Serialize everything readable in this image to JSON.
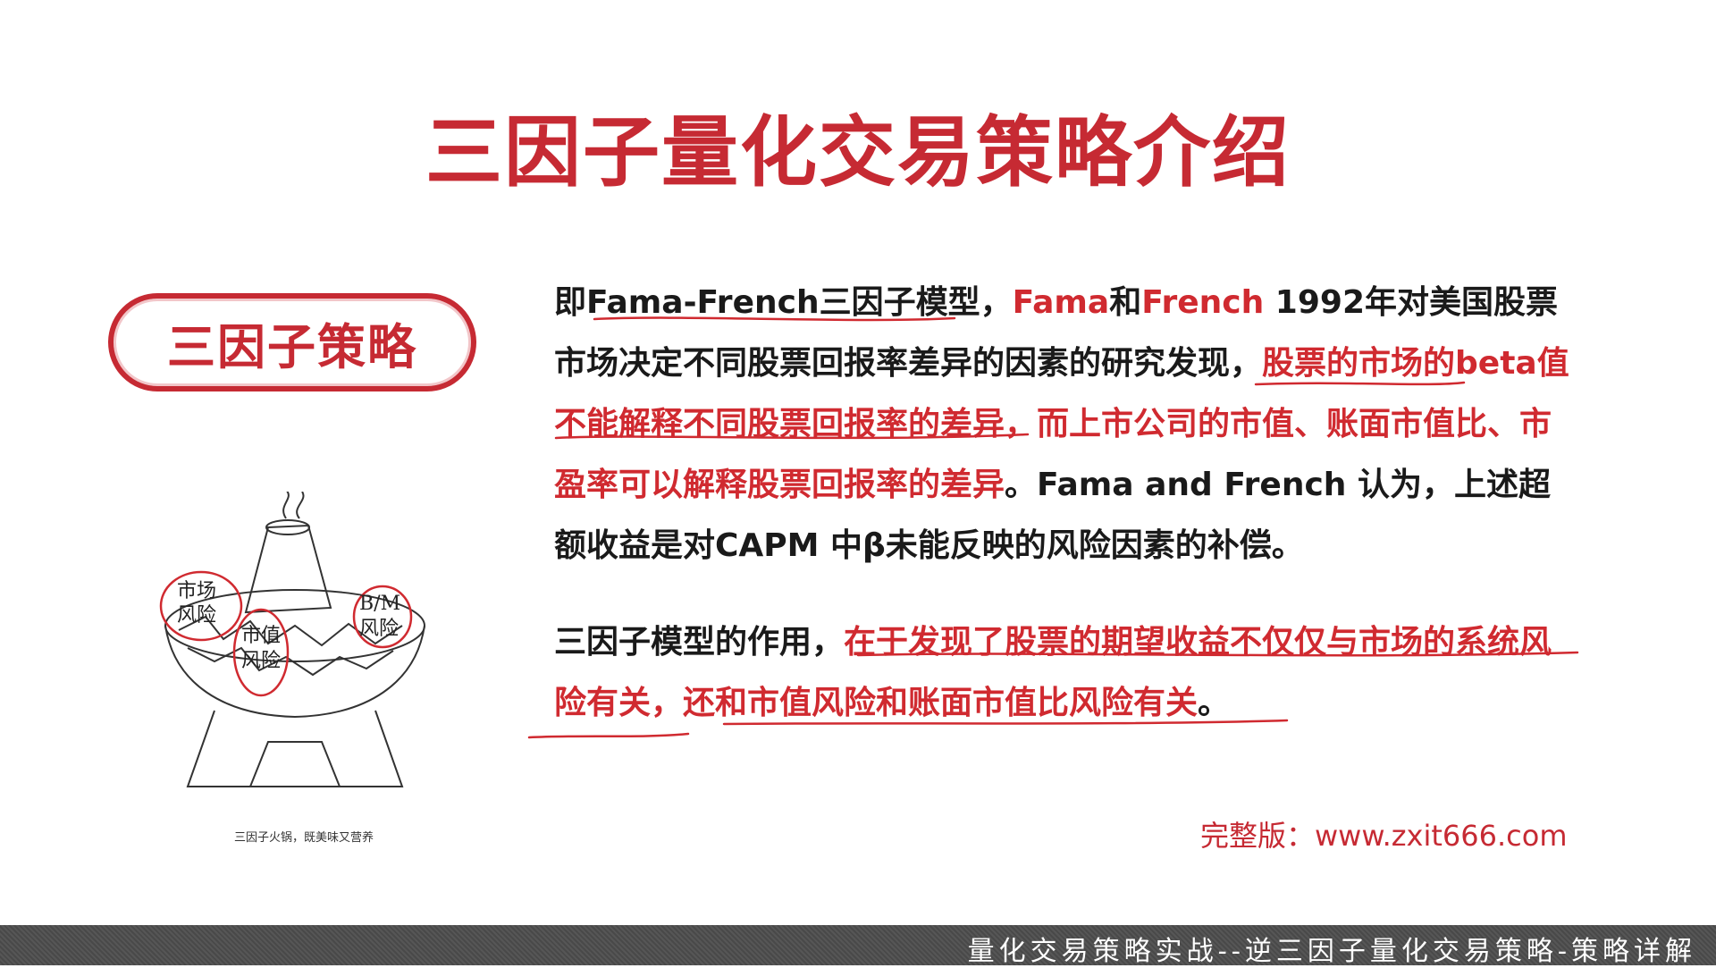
{
  "title": "三因子量化交易策略介绍",
  "badge": "三因子策略",
  "illustration": {
    "caption": "三因子火锅，既美味又营养",
    "labels": {
      "market": [
        "市场",
        "风险"
      ],
      "size": [
        "市值",
        "风险"
      ],
      "bm": [
        "B/M",
        "风险"
      ]
    }
  },
  "paragraph1": [
    {
      "text": "即Fama-French三因子模型，",
      "style": "black"
    },
    {
      "text": "Fama",
      "style": "red"
    },
    {
      "text": "和",
      "style": "black"
    },
    {
      "text": "French",
      "style": "red"
    },
    {
      "text": " 1992年对美国股票市场决定不同股票回报率差异的因素的研究发现，",
      "style": "black"
    },
    {
      "text": "股票的市场的beta值不能解释不同股票回报率的差异，而上市公司的市值、账面市值比、市盈率可以解释股票回报率的差异",
      "style": "red"
    },
    {
      "text": "。Fama and French 认为，上述超额收益是对CAPM 中β未能反映的风险因素的补偿。",
      "style": "black"
    }
  ],
  "paragraph2": [
    {
      "text": "三因子模型的作用，",
      "style": "black"
    },
    {
      "text": "在于发现了股票的期望收益不仅仅与市场的系统风险有关，还和市值风险和账面市值比风险有关",
      "style": "red"
    },
    {
      "text": "。",
      "style": "black"
    }
  ],
  "footer_link": "完整版：www.zxit666.com",
  "bottom_banner": "量化交易策略实战--逆三因子量化交易策略-策略详解",
  "colors": {
    "accent": "#c62a33",
    "text": "#1a1a1a",
    "banner": "#4d4d4d"
  }
}
